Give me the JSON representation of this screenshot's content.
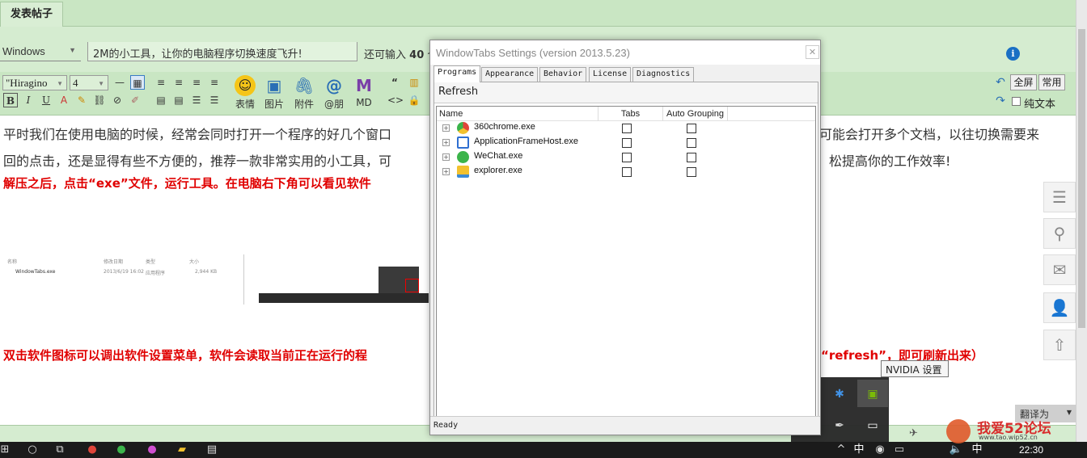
{
  "forum": {
    "tab_post": "发表帖子",
    "category": "Windows",
    "title": "2M的小工具，让你的电脑程序切换速度飞升!",
    "remaining_prefix": "还可输入",
    "remaining_count": "40",
    "remaining_suffix": "个"
  },
  "editor": {
    "font": "\"Hiragino",
    "size": "4",
    "tools": {
      "emoji": "表情",
      "image": "图片",
      "attach": "附件",
      "at": "@朋",
      "md": "MD"
    },
    "fullscreen": "全屏",
    "common": "常用",
    "plain_text": "纯文本",
    "bold": "B",
    "italic": "I",
    "underline": "U"
  },
  "content": {
    "para1_left": "平时我们在使用电脑的时候，经常会同时打开一个程序的好几个窗口",
    "para1_right": "可能会打开多个文档，以往切换需要来",
    "para2_left": "回的点击，还是显得有些不方便的，推荐一款非常实用的小工具，可",
    "para2_right": "松提高你的工作效率!",
    "red1": "解压之后，点击“exe”文件，运行工具。在电脑右下角可以看见软件",
    "red2_left": "双击软件图标可以调出软件设置菜单，软件会读取当前正在运行的程",
    "red2_right": "“refresh”，即可刷新出来）"
  },
  "shot": {
    "col_name": "名称",
    "col_date": "修改日期",
    "col_type": "类型",
    "col_size": "大小",
    "file_name": "WindowTabs.exe",
    "file_date": "2013/6/19 16:02",
    "file_type": "应用程序",
    "file_size": "2,944 KB"
  },
  "window": {
    "title": "WindowTabs Settings (version 2013.5.23)",
    "tabs": [
      "Programs",
      "Appearance",
      "Behavior",
      "License",
      "Diagnostics"
    ],
    "refresh_label": "Refresh",
    "columns": {
      "name": "Name",
      "tabs": "Tabs",
      "auto": "Auto Grouping"
    },
    "programs": [
      {
        "name": "360chrome.exe",
        "color": "#e0453a"
      },
      {
        "name": "ApplicationFrameHost.exe",
        "color": "#2f6fd1"
      },
      {
        "name": "WeChat.exe",
        "color": "#3bb44a"
      },
      {
        "name": "explorer.exe",
        "color": "#f2c12e"
      }
    ],
    "status": "Ready"
  },
  "tray": {
    "tooltip": "NVIDIA 设置"
  },
  "translate_label": "翻译为",
  "taskbar": {
    "ime": "中",
    "ime2": "中",
    "time": "22:30"
  },
  "watermark": {
    "text": "我爱52论坛",
    "url": "www.tao.wip52.cn"
  },
  "colors": {
    "forum_bg": "#c9e6c3",
    "red_text": "#e00000",
    "taskbar": "#1b1b1b"
  }
}
